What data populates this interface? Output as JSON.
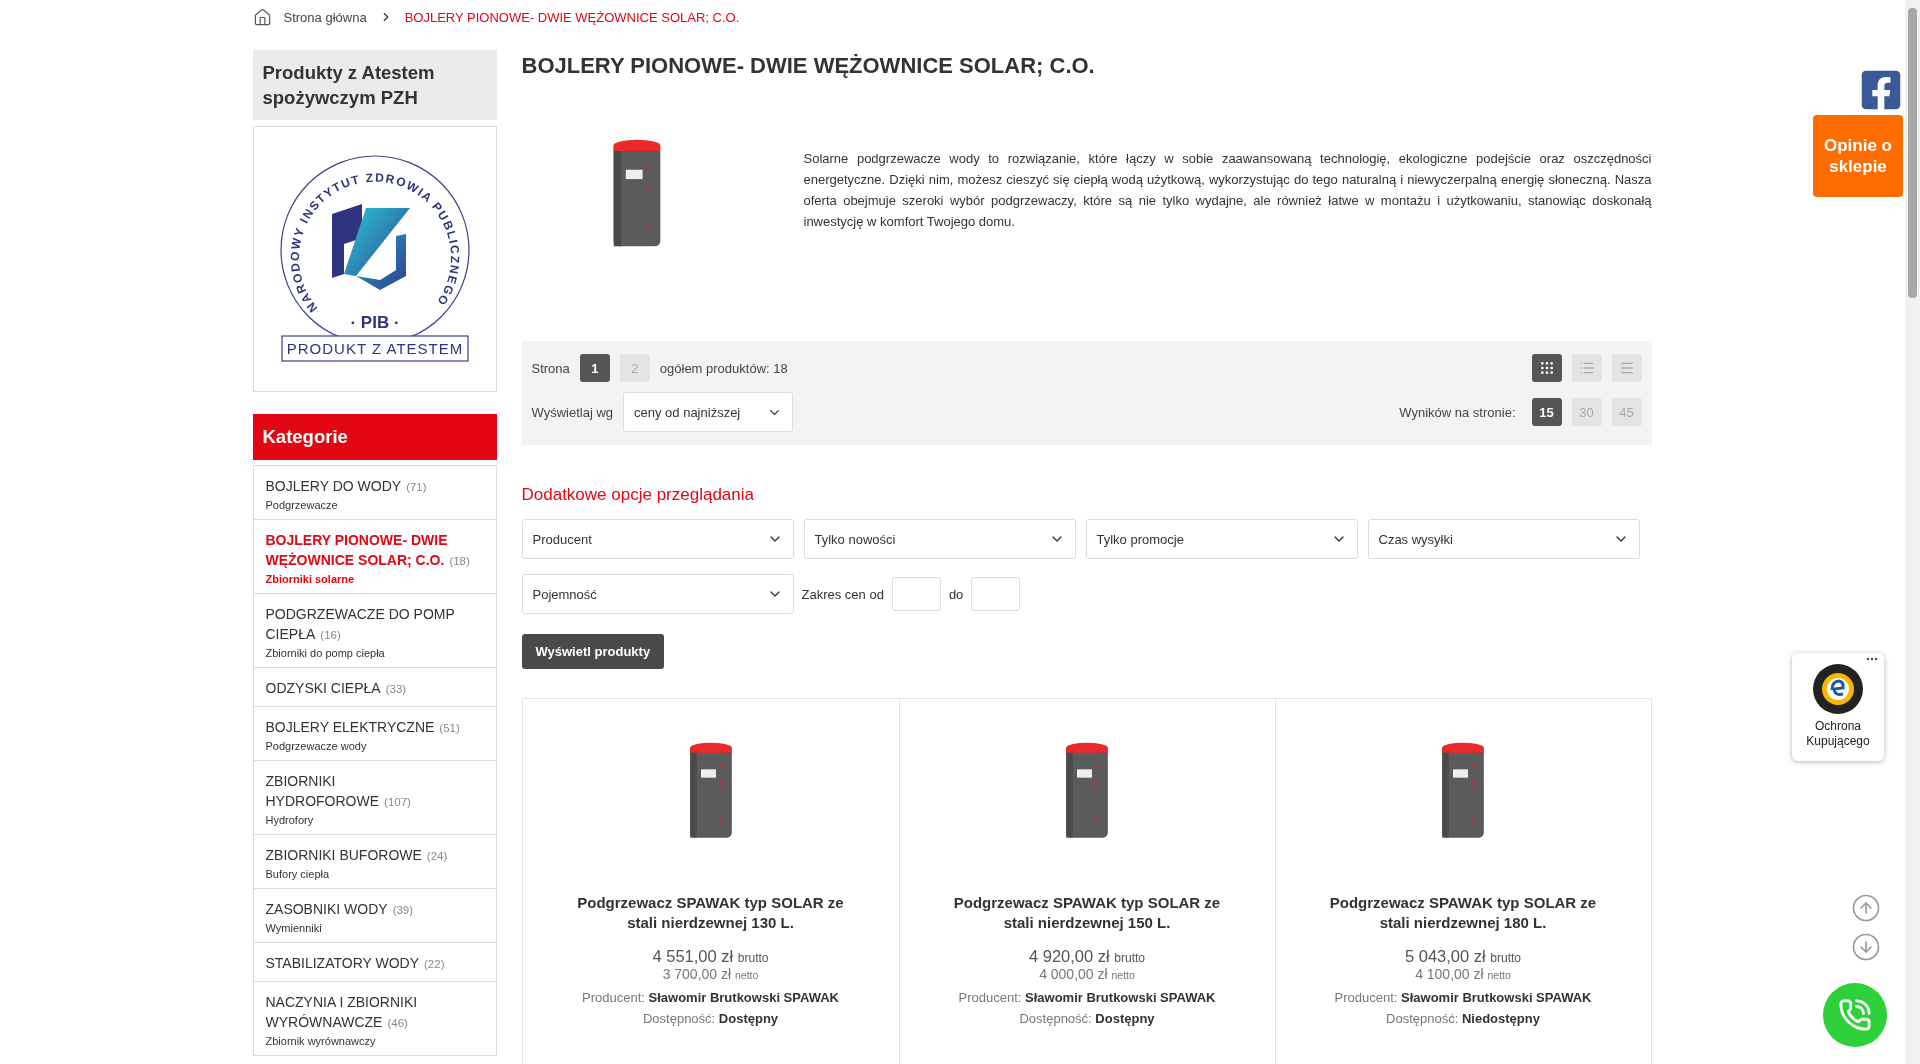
{
  "breadcrumb": {
    "items": [
      {
        "label": "Strona główna",
        "kind": "home"
      },
      {
        "label": "BOJLERY PIONOWE- DWIE WĘŻOWNICE SOLAR; C.O.",
        "kind": "current"
      }
    ]
  },
  "sidebar": {
    "promo_title": "Produkty z Atestem spożywczym PZH",
    "certificate": {
      "arc_text": "NARODOWY INSTYTUT ZDROWIA PUBLICZNEGO",
      "center_text": "· PIB ·",
      "banner": "PRODUKT Z ATESTEM"
    },
    "categories_title": "Kategorie",
    "categories": [
      {
        "name": "BOJLERY DO WODY",
        "count": "(71)",
        "subtitle": "Podgrzewacze",
        "selected": false
      },
      {
        "name": "BOJLERY PIONOWE- DWIE WĘŻOWNICE SOLAR; C.O.",
        "count": "(18)",
        "subtitle": "Zbiorniki solarne",
        "selected": true
      },
      {
        "name": "PODGRZEWACZE DO POMP CIEPŁA",
        "count": "(16)",
        "subtitle": "Zbiorniki do pomp ciepła",
        "selected": false
      },
      {
        "name": "ODZYSKI CIEPŁA",
        "count": "(33)",
        "selected": false
      },
      {
        "name": "BOJLERY ELEKTRYCZNE",
        "count": "(51)",
        "subtitle": "Podgrzewacze wody",
        "selected": false
      },
      {
        "name": "ZBIORNIKI HYDROFOROWE",
        "count": "(107)",
        "subtitle": "Hydrofory",
        "selected": false
      },
      {
        "name": "ZBIORNIKI BUFOROWE",
        "count": "(24)",
        "subtitle": "Bufory ciepła",
        "selected": false
      },
      {
        "name": "ZASOBNIKI WODY",
        "count": "(39)",
        "subtitle": "Wymienniki",
        "selected": false
      },
      {
        "name": "STABILIZATORY WODY",
        "count": "(22)",
        "selected": false
      },
      {
        "name": "NACZYNIA I ZBIORNIKI WYRÓWNAWCZE",
        "count": "(46)",
        "subtitle": "Zbiornik wyrównawczy",
        "selected": false
      }
    ]
  },
  "main": {
    "title": "BOJLERY PIONOWE- DWIE WĘŻOWNICE SOLAR; C.O.",
    "description": "Solarne podgrzewacze wody to rozwiązanie, które łączy w sobie zaawansowaną technologię, ekologiczne podejście oraz oszczędności energetyczne. Dzięki nim, możesz cieszyć się ciepłą wodą użytkową, wykorzystując do tego naturalną i niewyczerpalną energię słoneczną. Nasza oferta obejmuje szeroki wybór podgrzewaczy, które są nie tylko wydajne, ale również łatwe w montażu i użytkowaniu, stanowiąc doskonałą inwestycję w komfort Twojego domu.",
    "toolbar": {
      "page_label": "Strona",
      "pages": [
        {
          "label": "1",
          "selected": true
        },
        {
          "label": "2",
          "selected": false
        }
      ],
      "total": "ogółem produktów: 18",
      "sort_label": "Wyświetlaj wg",
      "sort_value": "ceny od najniższej",
      "views": [
        {
          "kind": "grid",
          "selected": true
        },
        {
          "kind": "list",
          "selected": false
        },
        {
          "kind": "rows",
          "selected": false
        }
      ],
      "per_page_label": "Wyników na stronie:",
      "per_page": [
        {
          "label": "15",
          "selected": true
        },
        {
          "label": "30",
          "selected": false
        },
        {
          "label": "45",
          "selected": false
        }
      ]
    },
    "filters": {
      "title": "Dodatkowe opcje przeglądania",
      "selects": [
        "Producent",
        "Tylko nowości",
        "Tylko promocje",
        "Czas wysyłki"
      ],
      "capacity": "Pojemność",
      "price_from_label": "Zakres cen od",
      "price_to_label": "do",
      "submit": "Wyświetl produkty"
    },
    "products": [
      {
        "name": "Podgrzewacz SPAWAK typ SOLAR ze stali nierdzewnej 130 L.",
        "gross": "4 551,00 zł",
        "gross_label": "brutto",
        "net": "3 700,00 zł",
        "net_label": "netto",
        "producer_label": "Producent:",
        "producer": "Sławomir Brutkowski SPAWAK",
        "availability_label": "Dostępność:",
        "availability": "Dostępny"
      },
      {
        "name": "Podgrzewacz SPAWAK typ SOLAR ze stali nierdzewnej 150 L.",
        "gross": "4 920,00 zł",
        "gross_label": "brutto",
        "net": "4 000,00 zł",
        "net_label": "netto",
        "producer_label": "Producent:",
        "producer": "Sławomir Brutkowski SPAWAK",
        "availability_label": "Dostępność:",
        "availability": "Dostępny"
      },
      {
        "name": "Podgrzewacz SPAWAK typ SOLAR ze stali nierdzewnej 180 L.",
        "gross": "5 043,00 zł",
        "gross_label": "brutto",
        "net": "4 100,00 zł",
        "net_label": "netto",
        "producer_label": "Producent:",
        "producer": "Sławomir Brutkowski SPAWAK",
        "availability_label": "Dostępność:",
        "availability": "Niedostępny"
      }
    ]
  },
  "widgets": {
    "reviews_button": "Opinie o sklepie",
    "trust_badge": "Ochrona Kupującego"
  }
}
